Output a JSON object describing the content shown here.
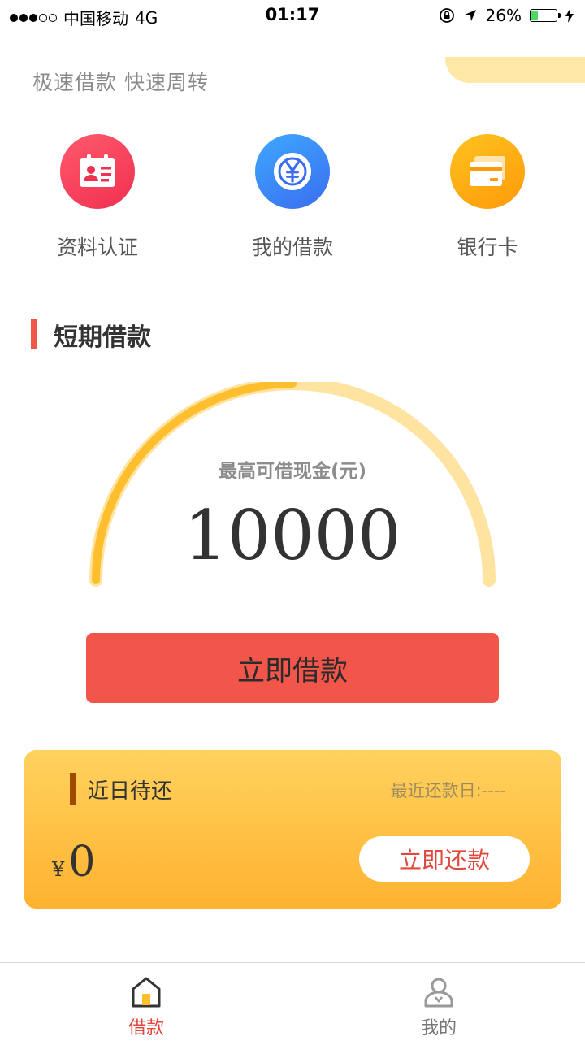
{
  "status_bar": {
    "carrier": "中国移动",
    "network": "4G",
    "time": "01:17",
    "battery_percent": "26%",
    "battery_level": 0.26
  },
  "header": {
    "slogan": "极速借款 快速周转"
  },
  "shortcuts": [
    {
      "label": "资料认证",
      "icon": "id-card-icon",
      "color": "#f0304f"
    },
    {
      "label": "我的借款",
      "icon": "yen-coin-icon",
      "color": "#3b6df0"
    },
    {
      "label": "银行卡",
      "icon": "bank-card-icon",
      "color": "#ff9a0a"
    }
  ],
  "section": {
    "title": "短期借款"
  },
  "gauge": {
    "label": "最高可借现金(元)",
    "value": "10000",
    "progress": 0.5
  },
  "borrow_button": {
    "label": "立即借款"
  },
  "repay_card": {
    "title": "近日待还",
    "latest_repay_date": "最近还款日:----",
    "currency": "¥",
    "amount": "0",
    "button_label": "立即还款"
  },
  "tab_bar": {
    "tabs": [
      {
        "label": "借款",
        "icon": "home-icon",
        "active": true
      },
      {
        "label": "我的",
        "icon": "user-icon",
        "active": false
      }
    ]
  },
  "colors": {
    "accent_red": "#f2554a",
    "gauge_track": "#ffe3a0",
    "gauge_progress": "#ffbe2e",
    "card_gradient_top": "#ffd25e",
    "card_gradient_bottom": "#ffb22f"
  }
}
